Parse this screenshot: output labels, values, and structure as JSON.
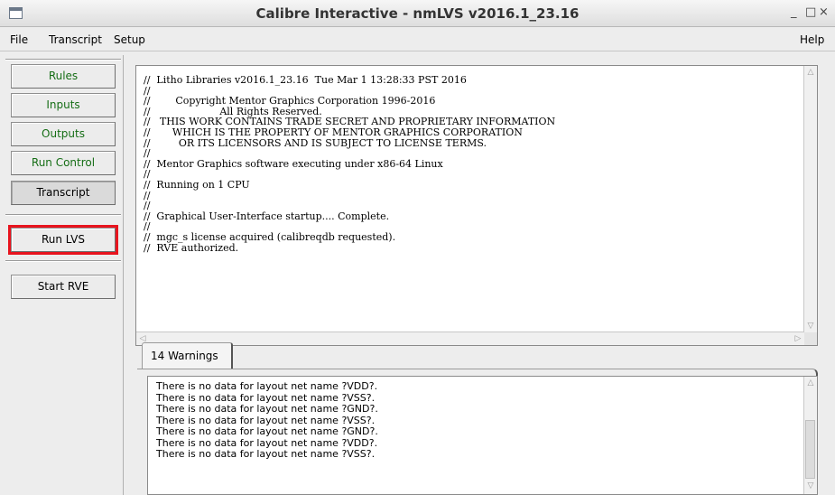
{
  "window": {
    "title": "Calibre Interactive - nmLVS v2016.1_23.16",
    "minimize": "_",
    "maximize": "□",
    "close": "×"
  },
  "menubar": {
    "items": [
      "File",
      "Transcript",
      "Setup"
    ],
    "help": "Help"
  },
  "sidebar": {
    "nav": [
      "Rules",
      "Inputs",
      "Outputs",
      "Run Control",
      "Transcript"
    ],
    "active": "Transcript",
    "run_lvs": "Run LVS",
    "start_rve": "Start RVE",
    "highlight_color": "#e8141e",
    "nav_text_color": "#166e16"
  },
  "transcript": {
    "lines": [
      "//  Litho Libraries v2016.1_23.16  Tue Mar 1 13:28:33 PST 2016",
      "//",
      "//        Copyright Mentor Graphics Corporation 1996-2016",
      "//                      All Rights Reserved.",
      "//   THIS WORK CONTAINS TRADE SECRET AND PROPRIETARY INFORMATION",
      "//       WHICH IS THE PROPERTY OF MENTOR GRAPHICS CORPORATION",
      "//         OR ITS LICENSORS AND IS SUBJECT TO LICENSE TERMS.",
      "//",
      "//  Mentor Graphics software executing under x86-64 Linux",
      "//",
      "//  Running on 1 CPU",
      "//",
      "//",
      "//  Graphical User-Interface startup.... Complete.",
      "//",
      "//  mgc_s license acquired (calibreqdb requested).",
      "//  RVE authorized."
    ]
  },
  "warnings": {
    "tab_label": "14 Warnings",
    "lines": [
      "There is no data for layout net name ?VDD?.",
      "There is no data for layout net name ?VSS?.",
      "There is no data for layout net name ?GND?.",
      "There is no data for layout net name ?VSS?.",
      "There is no data for layout net name ?GND?.",
      "There is no data for layout net name ?VDD?.",
      "There is no data for layout net name ?VSS?."
    ]
  }
}
